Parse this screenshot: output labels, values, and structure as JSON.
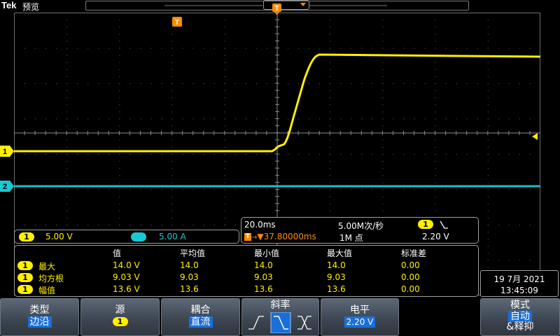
{
  "topbar": {
    "brand": "Tek",
    "mode": "预览"
  },
  "trigger_marker": "T",
  "channel_markers": {
    "ch1": "1",
    "ch2": "2"
  },
  "channel_settings": [
    {
      "num": "1",
      "value": "5.00 V",
      "color": "#ffef00"
    },
    {
      "num": "2",
      "value": "5.00 A",
      "color": "#19c8d2"
    }
  ],
  "timebase": {
    "horizontal_scale": "20.0ms",
    "sample_rate": "5.00M次/秒",
    "trigger_position": "▼37.80000ms",
    "record_length": "1M 点",
    "trigger_source": "1",
    "trigger_level": "2.20 V"
  },
  "measurements": {
    "headers": [
      "值",
      "平均值",
      "最小值",
      "最大值",
      "标准差"
    ],
    "rows": [
      {
        "ch": "1",
        "name": "最大",
        "values": [
          "14.0 V",
          "14.0",
          "14.0",
          "14.0",
          "0.00"
        ]
      },
      {
        "ch": "1",
        "name": "均方根",
        "values": [
          "9.03 V",
          "9.03",
          "9.03",
          "9.03",
          "0.00"
        ]
      },
      {
        "ch": "1",
        "name": "幅值",
        "values": [
          "13.6 V",
          "13.6",
          "13.6",
          "13.6",
          "0.00"
        ]
      }
    ]
  },
  "datetime": {
    "date": "19 7月 2021",
    "time": "13:45:09"
  },
  "menu": {
    "type": {
      "label": "类型",
      "value": "边沿"
    },
    "source": {
      "label": "源",
      "value": "1"
    },
    "coupling": {
      "label": "耦合",
      "value": "直流"
    },
    "slope": {
      "label": "斜率",
      "selected": "falling"
    },
    "level": {
      "label": "电平",
      "value": "2.20 V"
    },
    "mode": {
      "label": "模式",
      "value": "自动",
      "extra": "&释抑"
    }
  },
  "colors": {
    "ch1": "#ffef00",
    "ch2": "#19c8d2",
    "trigger": "#ff8c00",
    "menu_value": "#1a6fd8"
  }
}
